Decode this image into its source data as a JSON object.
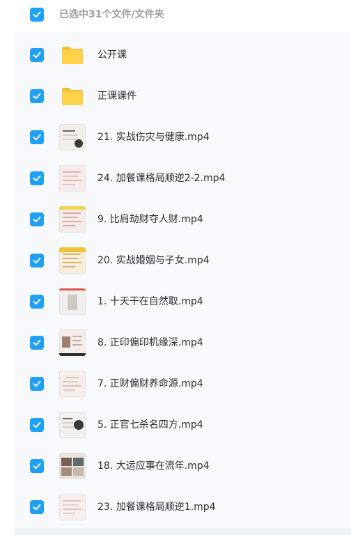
{
  "header": {
    "selection_text": "已选中31个文件/文件夹",
    "checkbox_checked": true
  },
  "files": [
    {
      "name": "公开课",
      "type": "folder",
      "checked": true
    },
    {
      "name": "正课课件",
      "type": "folder",
      "checked": true
    },
    {
      "name": "21. 实战伤灾与健康.mp4",
      "type": "video",
      "checked": true
    },
    {
      "name": "24. 加餐课格局顺逆2-2.mp4",
      "type": "video",
      "checked": true
    },
    {
      "name": "9. 比肩劫财夺人财.mp4",
      "type": "video",
      "checked": true
    },
    {
      "name": "20. 实战婚姻与子女.mp4",
      "type": "video",
      "checked": true
    },
    {
      "name": "1. 十天干在自然取.mp4",
      "type": "video",
      "checked": true
    },
    {
      "name": "8. 正印偏印机缘深.mp4",
      "type": "video",
      "checked": true
    },
    {
      "name": "7. 正财偏财养命源.mp4",
      "type": "video",
      "checked": true
    },
    {
      "name": "5. 正官七杀名四方.mp4",
      "type": "video",
      "checked": true
    },
    {
      "name": "18. 大运应事在流年.mp4",
      "type": "video",
      "checked": true
    },
    {
      "name": "23. 加餐课格局顺逆1.mp4",
      "type": "video",
      "checked": true
    }
  ],
  "colors": {
    "checkbox": "#1fa0f5",
    "folder": "#ffd24a",
    "header_text": "#9aa0a8",
    "row_text": "#2b2f36"
  },
  "icons": {
    "checkbox": "checkmark-icon",
    "folder": "folder-icon",
    "video": "video-thumbnail"
  }
}
